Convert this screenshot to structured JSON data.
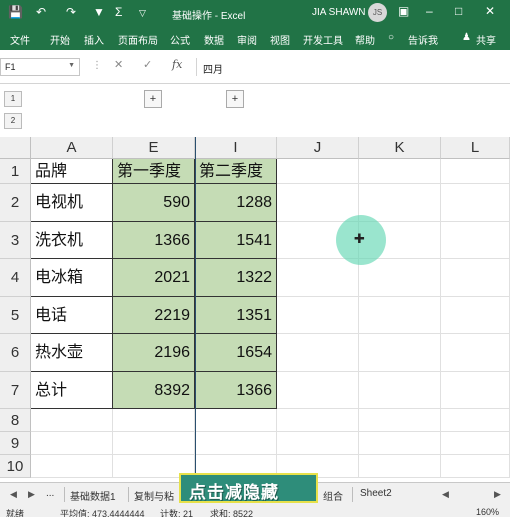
{
  "titlebar": {
    "save_icon": "save-icon",
    "undo_icon": "undo-icon",
    "redo_icon": "redo-icon",
    "filter_icon": "filter-icon",
    "autosum_icon": "autosum-icon",
    "doc_title": "基础操作 - Excel",
    "user": "JIA SHAWN",
    "avatar": "JS"
  },
  "ribbon": {
    "tabs": [
      "文件",
      "开始",
      "插入",
      "页面布局",
      "公式",
      "数据",
      "审阅",
      "视图",
      "开发工具",
      "帮助"
    ],
    "tell_me": "告诉我",
    "share": "共享"
  },
  "formula_bar": {
    "name_box": "F1",
    "formula": "四月"
  },
  "outline": {
    "levels": [
      "1",
      "2"
    ]
  },
  "columns": [
    "A",
    "E",
    "I",
    "J",
    "K",
    "L"
  ],
  "rows": [
    {
      "n": "1",
      "brand": "品牌",
      "q1": "第一季度",
      "q2": "第二季度"
    },
    {
      "n": "2",
      "brand": "电视机",
      "q1": "590",
      "q2": "1288"
    },
    {
      "n": "3",
      "brand": "洗衣机",
      "q1": "1366",
      "q2": "1541"
    },
    {
      "n": "4",
      "brand": "电冰箱",
      "q1": "2021",
      "q2": "1322"
    },
    {
      "n": "5",
      "brand": "电话",
      "q1": "2219",
      "q2": "1351"
    },
    {
      "n": "6",
      "brand": "热水壶",
      "q1": "2196",
      "q2": "1654"
    },
    {
      "n": "7",
      "brand": "总计",
      "q1": "8392",
      "q2": "1366"
    },
    {
      "n": "8",
      "brand": "",
      "q1": "",
      "q2": ""
    },
    {
      "n": "9",
      "brand": "",
      "q1": "",
      "q2": ""
    },
    {
      "n": "10",
      "brand": "",
      "q1": "",
      "q2": ""
    }
  ],
  "sheet_tabs": {
    "items": [
      "基础数据1",
      "复制与粘",
      "组合",
      "Sheet2"
    ],
    "ellipsis": "..."
  },
  "banner": "点击减隐藏",
  "status": {
    "ready": "就绪",
    "average": "平均值: 473.4444444",
    "count": "计数: 21",
    "sum": "求和: 8522",
    "zoom": "160%"
  },
  "colors": {
    "excel_green": "#217346",
    "cell_fill": "#c5dcb5",
    "banner_bg": "#2e8d7a"
  }
}
